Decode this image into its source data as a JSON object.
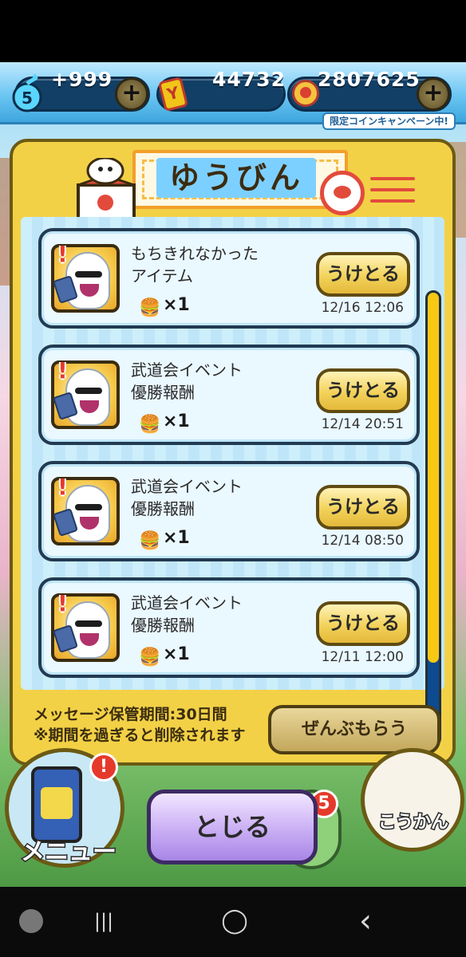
{
  "currency": {
    "spirit_count": "5",
    "spirit_amount": "+999",
    "ycard_letter": "Y",
    "points": "44732",
    "coins": "2807625",
    "campaign_label": "限定コインキャンペーン中!",
    "plus_symbol": "+"
  },
  "panel": {
    "title": "ゆうびん",
    "messages": [
      {
        "title": "もちきれなかった\nアイテム",
        "qty": "×1",
        "date": "12/16 12:06",
        "receive": "うけとる"
      },
      {
        "title": "武道会イベント\n優勝報酬",
        "qty": "×1",
        "date": "12/14 20:51",
        "receive": "うけとる"
      },
      {
        "title": "武道会イベント\n優勝報酬",
        "qty": "×1",
        "date": "12/14 08:50",
        "receive": "うけとる"
      },
      {
        "title": "武道会イベント\n優勝報酬",
        "qty": "×1",
        "date": "12/11 12:00",
        "receive": "うけとる"
      }
    ],
    "footer_line1": "メッセージ保管期間:30日間",
    "footer_line2": "※期間を過ぎると削除されます",
    "receive_all": "ぜんぶもらう",
    "scroll_fraction": 0.82
  },
  "bottom": {
    "menu_label": "メニュー",
    "menu_badge": "!",
    "close_label": "とじる",
    "notif_count": "5",
    "exchange_label": "こうかん"
  },
  "android_nav": {
    "recent": "|||",
    "home": "◯",
    "back": "‹"
  },
  "colors": {
    "panel_yellow": "#f3d146",
    "button_yellow": "#f2d25a",
    "close_purple": "#c9aef4",
    "scroll_track": "#0d4a8f",
    "alert_red": "#e53a2b"
  },
  "icons": {
    "item": "hamburger-icon",
    "stamp": "postmark-icon",
    "avatar": "whisper-ghost-icon"
  }
}
